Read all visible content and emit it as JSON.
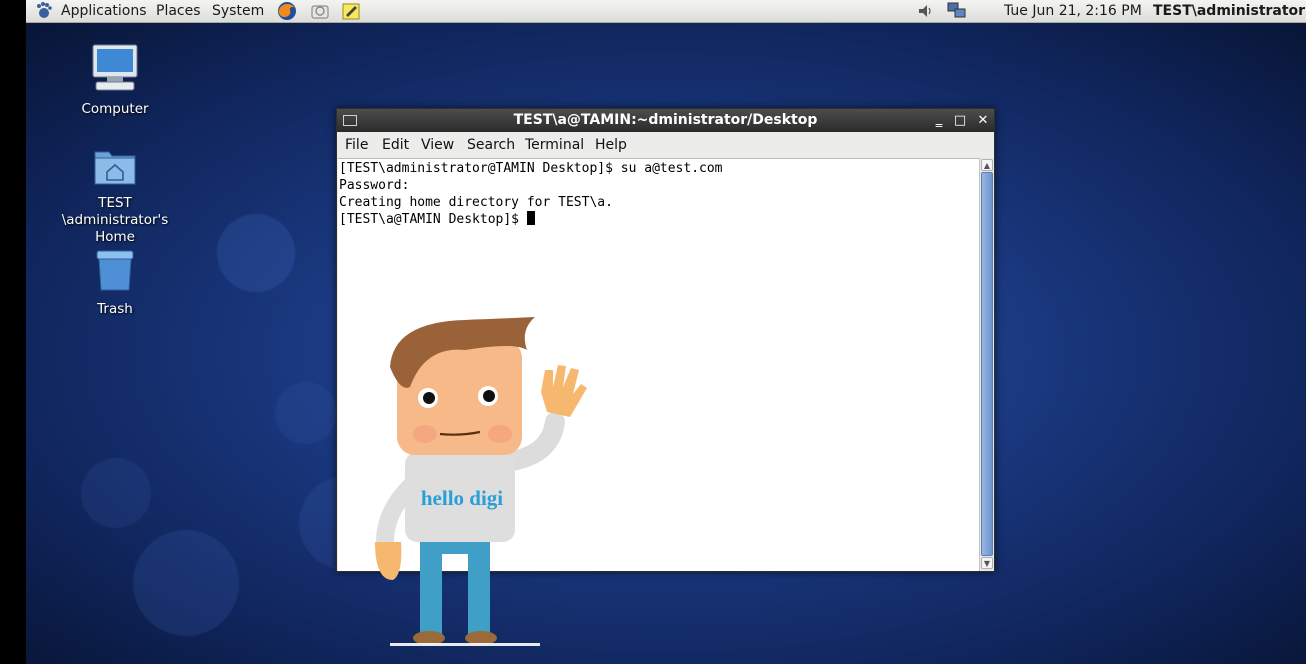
{
  "panel": {
    "menus": [
      "Applications",
      "Places",
      "System"
    ],
    "clock": "Tue Jun 21,  2:16 PM",
    "user": "TEST\\administrator"
  },
  "desktop_icons": [
    {
      "label": "Computer"
    },
    {
      "label": "TEST\n\\administrator's\nHome"
    },
    {
      "label": "Trash"
    }
  ],
  "window": {
    "title": "TEST\\a@TAMIN:~dministrator/Desktop",
    "menu": [
      "File",
      "Edit",
      "View",
      "Search",
      "Terminal",
      "Help"
    ],
    "terminal_lines": [
      "[TEST\\administrator@TAMIN Desktop]$ su a@test.com",
      "Password:",
      "Creating home directory for TEST\\a.",
      "[TEST\\a@TAMIN Desktop]$ "
    ]
  },
  "mascot": {
    "shirt_text": "hello digi"
  },
  "colors": {
    "desktop": "#1b3a82",
    "panel": "#e8e8e6",
    "titlebar": "#3a3a3a",
    "scroll_thumb": "#7ea3d8",
    "shirt_text": "#2a9fd6"
  }
}
